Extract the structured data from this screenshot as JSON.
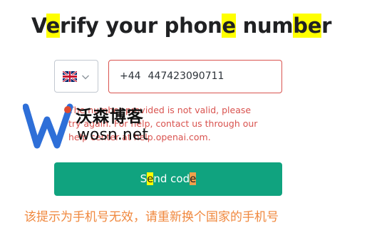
{
  "title": {
    "segments": [
      "V",
      "e",
      "rify your phon",
      "e",
      " num",
      "b",
      "e",
      "r"
    ]
  },
  "country_select": {
    "flag_icon": "uk-flag-icon",
    "chevron_icon": "chevron-down-icon"
  },
  "phone_input": {
    "prefix": "+44",
    "value": "447423090711"
  },
  "error_message": {
    "lines": [
      "The number provided is not valid, please",
      "try again. For help, contact us through our",
      "help center at help.openai.com."
    ],
    "color": "#d9534f"
  },
  "watermark": {
    "logo_text": "沃森博客",
    "url_text": "wosn.net"
  },
  "send_button": {
    "parts": [
      "S",
      "e",
      "nd cod",
      "e"
    ],
    "color": "#10a37f"
  },
  "annotation": {
    "text": "该提示为手机号无效，请重新换个国家的手机号",
    "color": "#f0883e"
  },
  "highlight_colors": [
    "#ffff00",
    "#f0a04b"
  ]
}
